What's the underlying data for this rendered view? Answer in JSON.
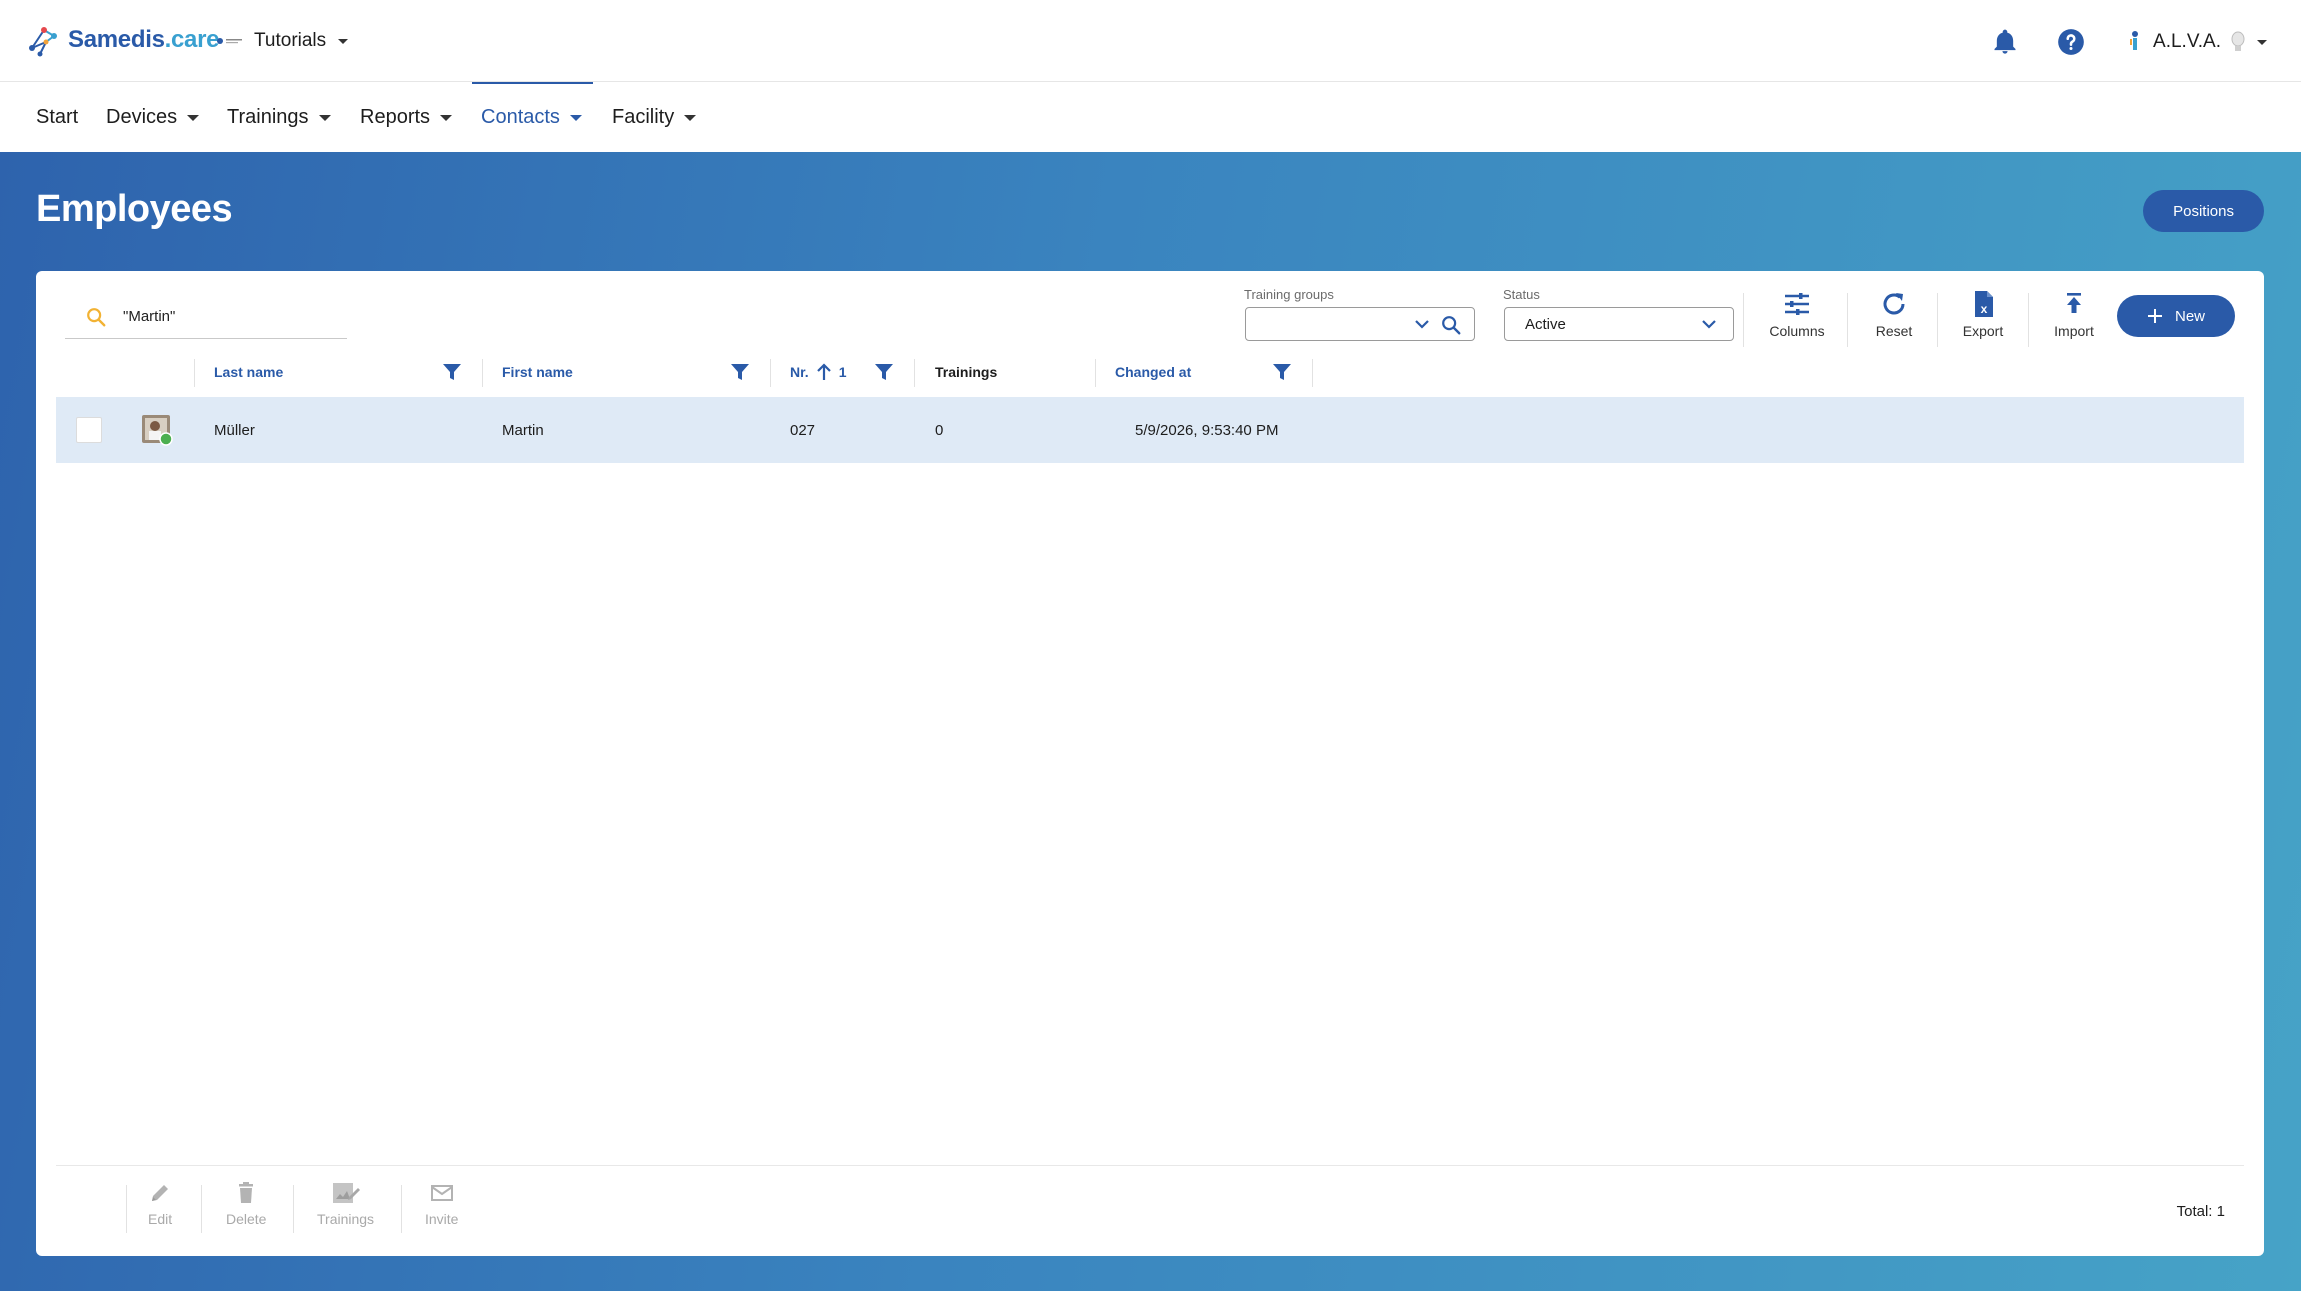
{
  "app": {
    "brand_name": "Samedis",
    "brand_suffix": ".care",
    "tenant_name": "Tutorials",
    "user_name": "A.L.V.A."
  },
  "nav": {
    "items": [
      {
        "label": "Start"
      },
      {
        "label": "Devices"
      },
      {
        "label": "Trainings"
      },
      {
        "label": "Reports"
      },
      {
        "label": "Contacts"
      },
      {
        "label": "Facility"
      }
    ],
    "active": "Contacts"
  },
  "page": {
    "title": "Employees",
    "positions_label": "Positions"
  },
  "filters": {
    "search_value": "\"Martin\"",
    "training_groups_label": "Training groups",
    "training_groups_value": "",
    "status_label": "Status",
    "status_value": "Active"
  },
  "toolbar": {
    "columns_label": "Columns",
    "reset_label": "Reset",
    "export_label": "Export",
    "import_label": "Import",
    "new_label": "New"
  },
  "table": {
    "columns": [
      {
        "label": "Last name"
      },
      {
        "label": "First name"
      },
      {
        "label": "Nr."
      },
      {
        "label": "Trainings"
      },
      {
        "label": "Changed at"
      }
    ],
    "sort_indicator": "1",
    "rows": [
      {
        "last_name": "Müller",
        "first_name": "Martin",
        "nr": "027",
        "trainings": "0",
        "changed_at": "5/9/2026, 9:53:40 PM"
      }
    ]
  },
  "footer": {
    "edit_label": "Edit",
    "delete_label": "Delete",
    "trainings_label": "Trainings",
    "invite_label": "Invite",
    "total_label": "Total: 1"
  },
  "colors": {
    "primary": "#2a5aa8",
    "row_selected": "#dfeaf6",
    "gradient_start": "#2e63ad",
    "gradient_end": "#46a3c7"
  }
}
